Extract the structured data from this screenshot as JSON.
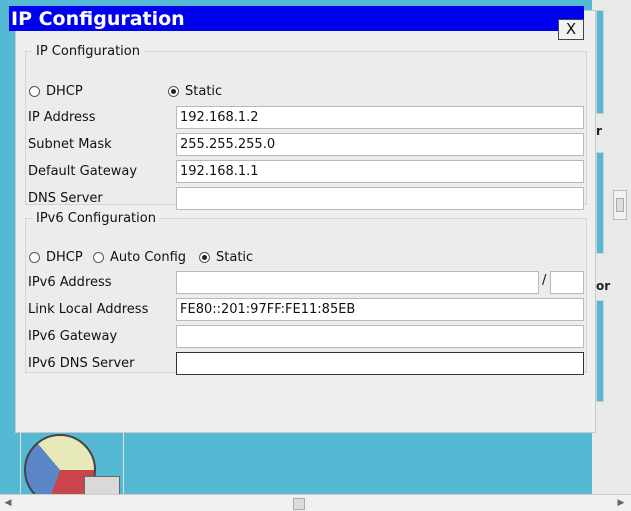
{
  "dialog": {
    "title": "IP Configuration",
    "close_label": "X"
  },
  "ipv4": {
    "legend": "IP Configuration",
    "mode_options": [
      {
        "label": "DHCP",
        "selected": false
      },
      {
        "label": "Static",
        "selected": true
      }
    ],
    "fields": {
      "ip_address": {
        "label": "IP Address",
        "value": "192.168.1.2"
      },
      "subnet_mask": {
        "label": "Subnet Mask",
        "value": "255.255.255.0"
      },
      "default_gateway": {
        "label": "Default Gateway",
        "value": "192.168.1.1"
      },
      "dns_server": {
        "label": "DNS Server",
        "value": ""
      }
    }
  },
  "ipv6": {
    "legend": "IPv6 Configuration",
    "mode_options": [
      {
        "label": "DHCP",
        "selected": false
      },
      {
        "label": "Auto Config",
        "selected": false
      },
      {
        "label": "Static",
        "selected": true
      }
    ],
    "prefix_separator": "/",
    "fields": {
      "ipv6_address": {
        "label": "IPv6 Address",
        "value": "",
        "prefix_length": ""
      },
      "link_local_address": {
        "label": "Link Local Address",
        "value": "FE80::201:97FF:FE11:85EB"
      },
      "ipv6_gateway": {
        "label": "IPv6 Gateway",
        "value": ""
      },
      "ipv6_dns_server": {
        "label": "IPv6 DNS Server",
        "value": ""
      }
    }
  },
  "background": {
    "fragment_r": "r",
    "fragment_or": "or"
  },
  "scrollbar": {
    "left_arrow": "◀",
    "right_arrow": "▶"
  },
  "colors": {
    "titlebar": "#0000f0",
    "desktop": "#55b9d3",
    "dialog": "#efefef"
  }
}
